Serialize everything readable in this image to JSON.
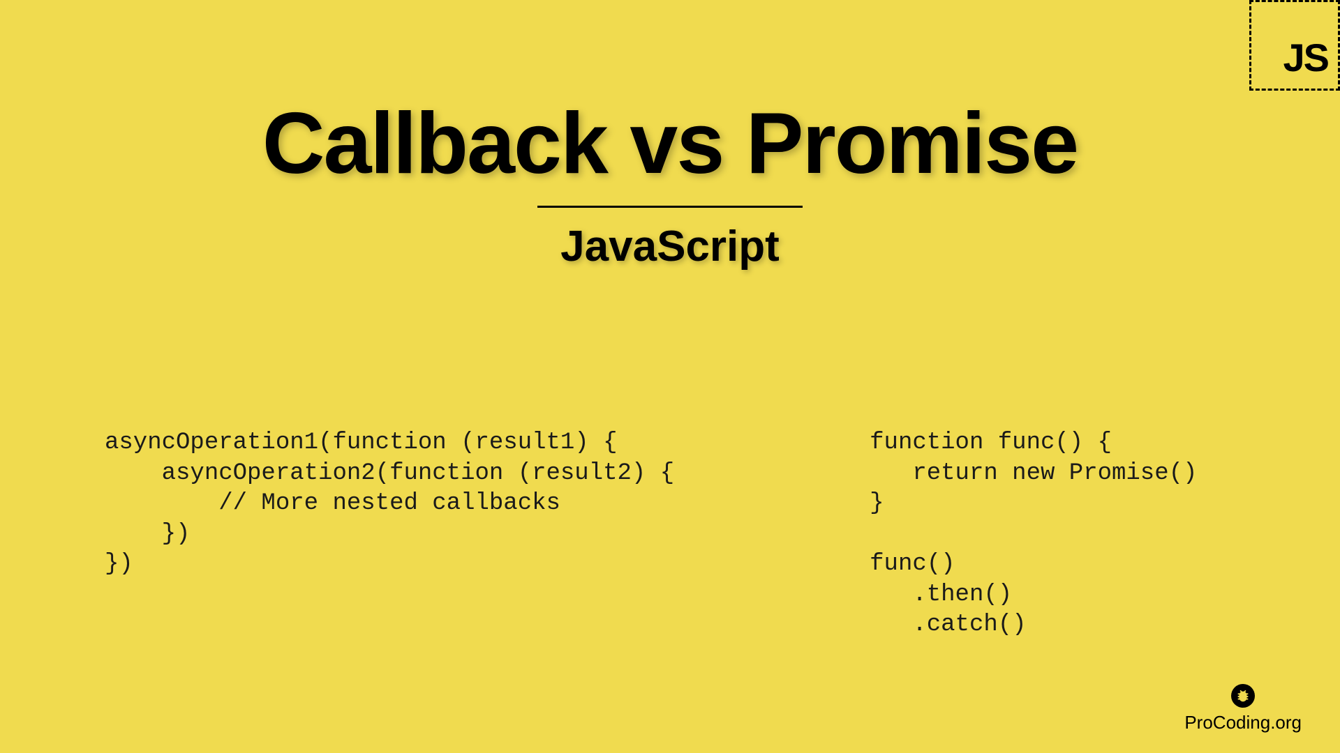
{
  "badge": {
    "text": "JS"
  },
  "header": {
    "title": "Callback vs Promise",
    "subtitle": "JavaScript"
  },
  "code": {
    "callback": "asyncOperation1(function (result1) {\n    asyncOperation2(function (result2) {\n        // More nested callbacks\n    })\n})",
    "promise": "function func() {\n   return new Promise()\n}\n\nfunc()\n   .then()\n   .catch()"
  },
  "footer": {
    "text": "ProCoding.org"
  }
}
